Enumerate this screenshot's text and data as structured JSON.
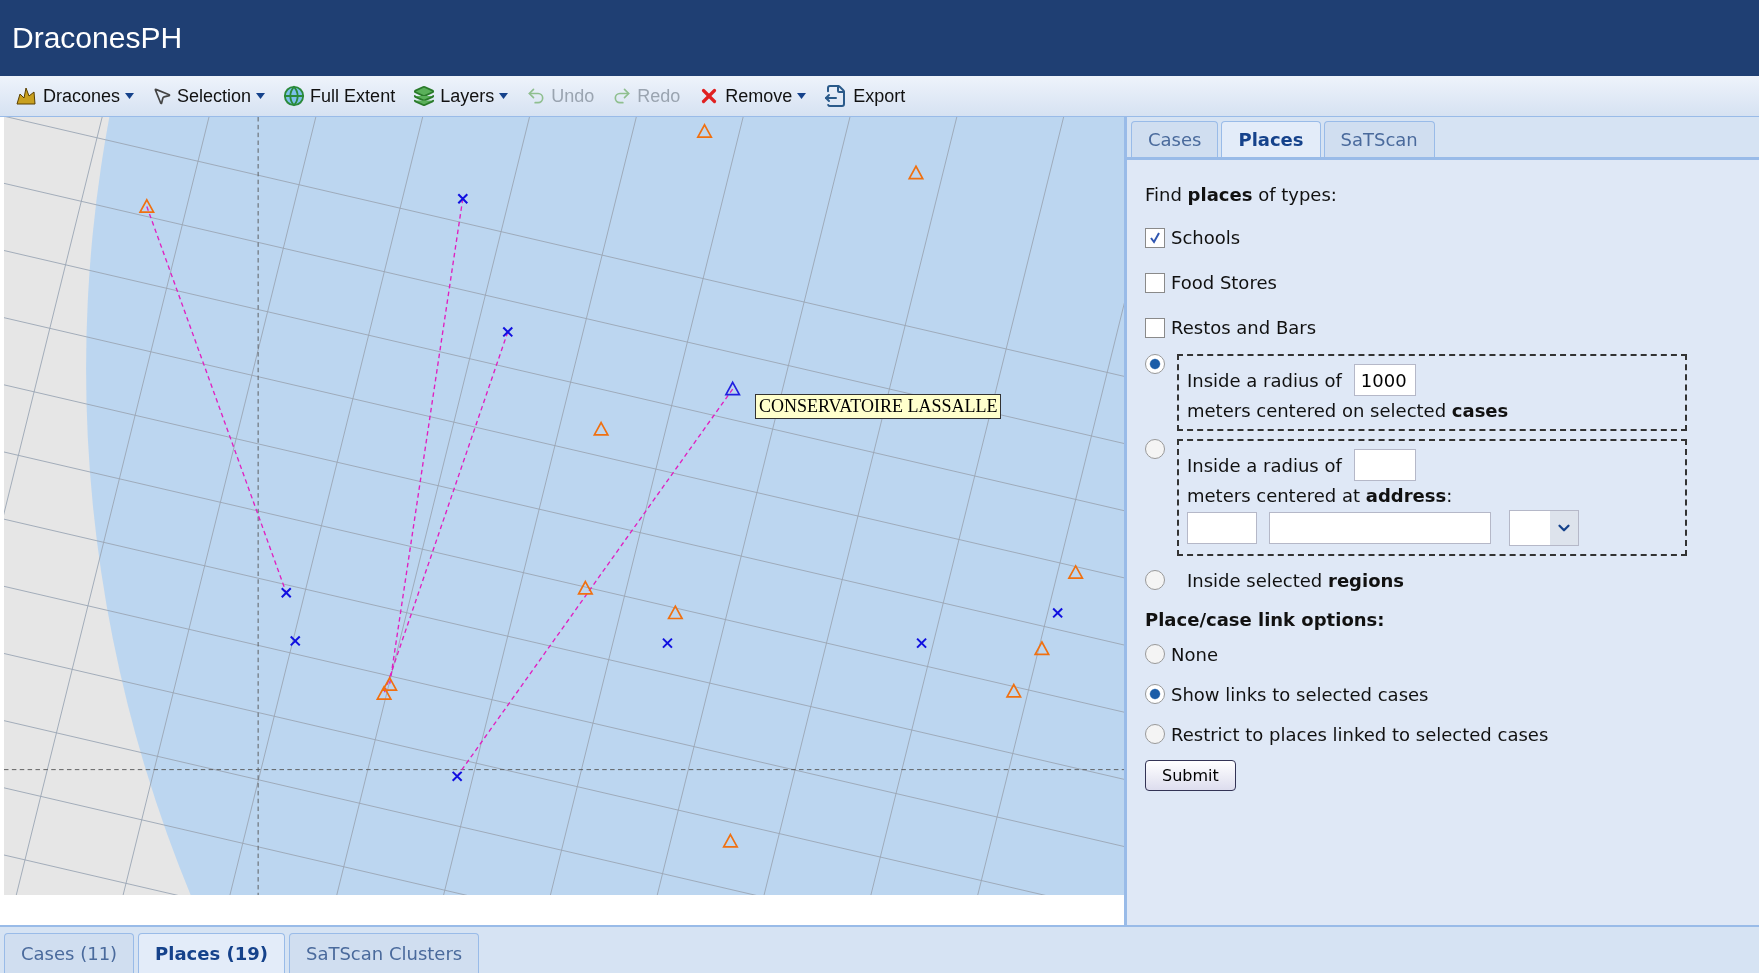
{
  "app": {
    "title": "DraconesPH"
  },
  "toolbar": [
    {
      "kind": "dracones",
      "label": "Dracones",
      "dropdown": true,
      "disabled": false
    },
    {
      "kind": "selection",
      "label": "Selection",
      "dropdown": true,
      "disabled": false
    },
    {
      "kind": "extent",
      "label": "Full Extent",
      "dropdown": false,
      "disabled": false
    },
    {
      "kind": "layers",
      "label": "Layers",
      "dropdown": true,
      "disabled": false
    },
    {
      "kind": "undo",
      "label": "Undo",
      "dropdown": false,
      "disabled": true
    },
    {
      "kind": "redo",
      "label": "Redo",
      "dropdown": false,
      "disabled": true
    },
    {
      "kind": "remove",
      "label": "Remove",
      "dropdown": true,
      "disabled": false
    },
    {
      "kind": "export",
      "label": "Export",
      "dropdown": false,
      "disabled": false
    }
  ],
  "map": {
    "tooltip": "CONSERVATOIRE LASSALLE"
  },
  "panel_tabs": [
    {
      "label": "Cases",
      "selected": false
    },
    {
      "label": "Places",
      "selected": true
    },
    {
      "label": "SaTScan",
      "selected": false
    }
  ],
  "form": {
    "intro": "Find **places** of types:",
    "place_types": [
      {
        "label": "Schools",
        "checked": true
      },
      {
        "label": "Food Stores",
        "checked": false
      },
      {
        "label": "Restos and Bars",
        "checked": false
      }
    ],
    "areas": [
      {
        "kind": "cases",
        "selected": true,
        "prefix": "Inside a radius of",
        "radius": "1000",
        "suffix": "meters centered on selected **cases**"
      },
      {
        "kind": "address",
        "selected": false,
        "prefix": "Inside a radius of",
        "suffix": "meters centered at **address**:"
      },
      {
        "kind": "regions",
        "selected": false,
        "prefix": "Inside selected **regions**"
      }
    ],
    "link_heading": "Place/case link options:",
    "link_options": [
      {
        "label": "None",
        "selected": false
      },
      {
        "label": "Show links to selected cases",
        "selected": true
      },
      {
        "label": "Restrict to places linked to selected cases",
        "selected": false
      }
    ],
    "submit": "Submit"
  },
  "bottom_tabs": [
    {
      "label": "Cases (11)",
      "selected": false
    },
    {
      "label": "Places (19)",
      "selected": true
    },
    {
      "label": "SaTScan Clusters",
      "selected": false
    }
  ]
}
